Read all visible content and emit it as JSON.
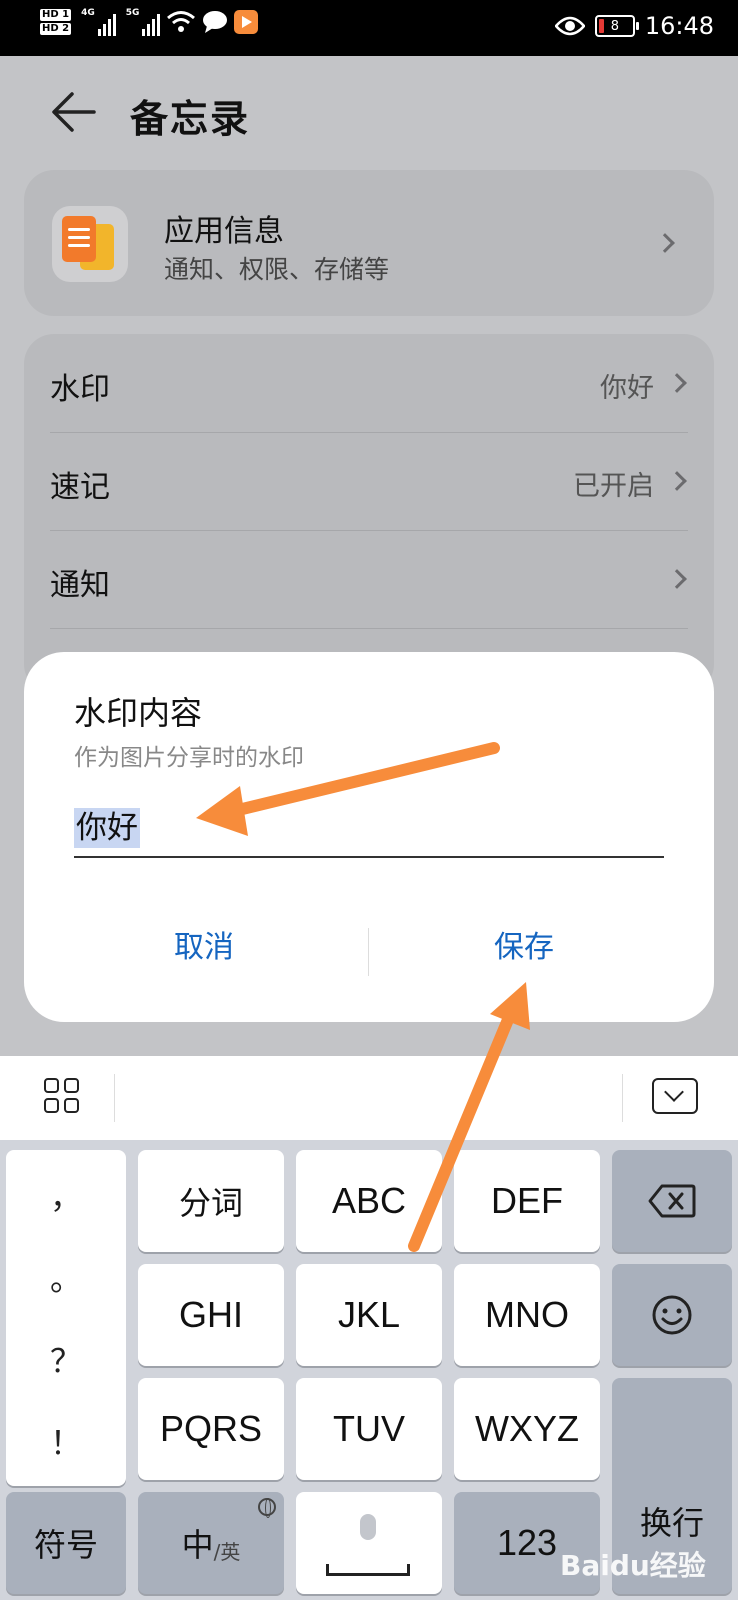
{
  "status_bar": {
    "hd1": "HD 1",
    "hd2": "HD 2",
    "net1": "4G",
    "net2": "5G",
    "battery": "8",
    "time": "16:48"
  },
  "header": {
    "title": "备忘录"
  },
  "app_info": {
    "title": "应用信息",
    "subtitle": "通知、权限、存储等"
  },
  "settings": [
    {
      "label": "水印",
      "value": "你好"
    },
    {
      "label": "速记",
      "value": "已开启"
    },
    {
      "label": "通知",
      "value": ""
    }
  ],
  "dialog": {
    "title": "水印内容",
    "subtitle": "作为图片分享时的水印",
    "input_value": "你好",
    "cancel": "取消",
    "save": "保存"
  },
  "keyboard": {
    "punct": [
      "，",
      "。",
      "？",
      "！"
    ],
    "row1": [
      "分词",
      "ABC",
      "DEF"
    ],
    "row2": [
      "GHI",
      "JKL",
      "MNO"
    ],
    "row3": [
      "PQRS",
      "TUV",
      "WXYZ"
    ],
    "symbols": "符号",
    "lang_main": "中",
    "lang_alt": "/英",
    "numbers": "123",
    "enter": "换行"
  },
  "colors": {
    "accent_blue": "#1565c0",
    "annotation_orange": "#f78c3b",
    "selection": "#c8d6f2"
  },
  "watermark": "Baidu经验"
}
